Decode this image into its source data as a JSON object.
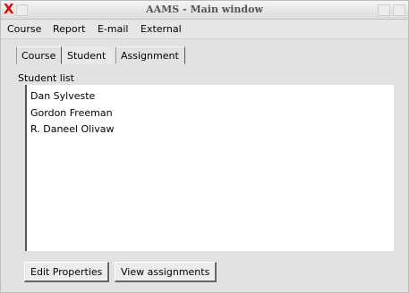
{
  "window": {
    "title": "AAMS - Main window",
    "close_glyph": "X"
  },
  "menubar": {
    "items": [
      "Course",
      "Report",
      "E-mail",
      "External"
    ]
  },
  "tabs": [
    {
      "label": "Course",
      "selected": false
    },
    {
      "label": "Student",
      "selected": true
    },
    {
      "label": "Assignment",
      "selected": false
    }
  ],
  "student_list": {
    "group_label": "Student list",
    "items": [
      "Dan Sylveste",
      "Gordon Freeman",
      "R. Daneel Olivaw"
    ]
  },
  "buttons": {
    "edit_properties": "Edit Properties",
    "view_assignments": "View assignments"
  },
  "colors": {
    "close_x": "#d01010",
    "window_bg": "#e2e2e2",
    "list_bg": "#ffffff"
  }
}
